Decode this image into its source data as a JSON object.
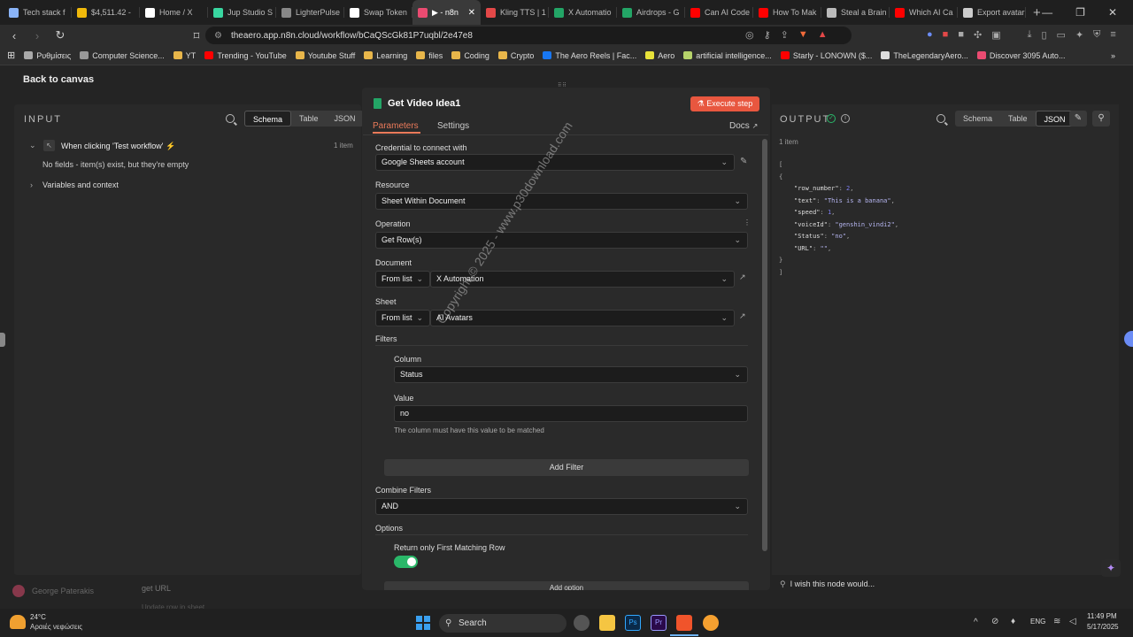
{
  "browser": {
    "tabs": [
      {
        "label": "Tech stack f",
        "color": "#8ab4f8"
      },
      {
        "label": "$4,511.42 -",
        "color": "#f0b90b"
      },
      {
        "label": "Home / X",
        "color": "#ffffff"
      },
      {
        "label": "Jup Studio S",
        "color": "#39d6a0"
      },
      {
        "label": "LighterPulse",
        "color": "#888888"
      },
      {
        "label": "Swap Token",
        "color": "#ffffff"
      },
      {
        "label": "▶ - n8n",
        "color": "#ea4b71"
      },
      {
        "label": "Kling TTS | 1",
        "color": "#e34848"
      },
      {
        "label": "X Automatio",
        "color": "#23a566"
      },
      {
        "label": "Airdrops - G",
        "color": "#23a566"
      },
      {
        "label": "Can AI Code",
        "color": "#ff0000"
      },
      {
        "label": "How To Mak",
        "color": "#ff0000"
      },
      {
        "label": "Steal a Brain",
        "color": "#bbbbbb"
      },
      {
        "label": "Which AI Ca",
        "color": "#ff0000"
      },
      {
        "label": "Export avatar",
        "color": "#cccccc"
      }
    ],
    "active_tab_index": 6,
    "url": "theaero.app.n8n.cloud/workflow/bCaQScGk81P7uqbl/2e47e8",
    "bookmarks": [
      {
        "label": "Ρυθμίσεις",
        "color": "#aaaaaa"
      },
      {
        "label": "Computer Science...",
        "color": "#999999"
      },
      {
        "label": "YT",
        "color": "#e8b64a"
      },
      {
        "label": "Trending - YouTube",
        "color": "#ff0000"
      },
      {
        "label": "Youtube Stuff",
        "color": "#e8b64a"
      },
      {
        "label": "Learning",
        "color": "#e8b64a"
      },
      {
        "label": "files",
        "color": "#e8b64a"
      },
      {
        "label": "Coding",
        "color": "#e8b64a"
      },
      {
        "label": "Crypto",
        "color": "#e8b64a"
      },
      {
        "label": "The Aero Reels | Fac...",
        "color": "#1877f2"
      },
      {
        "label": "Aero",
        "color": "#e8e23a"
      },
      {
        "label": "artificial intelligence...",
        "color": "#b6d36a"
      },
      {
        "label": "Starly - LONOWN ($...",
        "color": "#ff0000"
      },
      {
        "label": "TheLegendaryAero...",
        "color": "#dddddd"
      },
      {
        "label": "Discover 3095 Auto...",
        "color": "#ea4b71"
      }
    ]
  },
  "canvas": {
    "back_label": "Back to canvas",
    "bottom_left_user": "George Paterakis",
    "node_a": "get URL",
    "node_b": "Update row in sheet"
  },
  "input": {
    "title": "INPUT",
    "views": [
      "Schema",
      "Table",
      "JSON"
    ],
    "trigger": "When clicking 'Test workflow'",
    "count": "1 item",
    "empty_msg": "No fields - item(s) exist, but they're empty",
    "vars": "Variables and context"
  },
  "output": {
    "title": "OUTPUT",
    "views": [
      "Schema",
      "Table",
      "JSON"
    ],
    "count": "1 item",
    "json_lines": [
      {
        "t": "["
      },
      {
        "t": "  {"
      },
      {
        "k": "\"row_number\"",
        "v": "2",
        "vt": "n"
      },
      {
        "k": "\"text\"",
        "v": "\"This is a banana\"",
        "vt": "s"
      },
      {
        "k": "\"speed\"",
        "v": "1",
        "vt": "n"
      },
      {
        "k": "\"voiceId\"",
        "v": "\"genshin_vindi2\"",
        "vt": "s"
      },
      {
        "k": "\"Status\"",
        "v": "\"no\"",
        "vt": "s"
      },
      {
        "k": "\"URL\"",
        "v": "\"\"",
        "vt": "s"
      },
      {
        "t": "  }"
      },
      {
        "t": "]"
      }
    ],
    "feedback": "I wish this node would..."
  },
  "modal": {
    "title": "Get Video Idea1",
    "execute": "Execute step",
    "tabs": [
      "Parameters",
      "Settings"
    ],
    "docs": "Docs",
    "credential_label": "Credential to connect with",
    "credential_value": "Google Sheets account",
    "resource_label": "Resource",
    "resource_value": "Sheet Within Document",
    "operation_label": "Operation",
    "operation_value": "Get Row(s)",
    "document_label": "Document",
    "document_mode": "From list",
    "document_value": "X Automation",
    "sheet_label": "Sheet",
    "sheet_mode": "From list",
    "sheet_value": "AI Avatars",
    "filters_label": "Filters",
    "column_label": "Column",
    "column_value": "Status",
    "value_label": "Value",
    "value_value": "no",
    "value_hint": "The column must have this value to be matched",
    "add_filter": "Add Filter",
    "combine_label": "Combine Filters",
    "combine_value": "AND",
    "options_label": "Options",
    "first_row_label": "Return only First Matching Row",
    "first_row_on": true,
    "add_option": "Add option"
  },
  "watermark": "Copyright © 2025 - www.p30download.com",
  "taskbar": {
    "weather_temp": "24°C",
    "weather_desc": "Αραιές νεφώσεις",
    "search": "Search",
    "lang": "ENG",
    "time": "11:49 PM",
    "date": "5/17/2025"
  },
  "colors": {
    "accent": "#ea4b71",
    "execute": "#e8573f",
    "toggle": "#2ab769",
    "sheets": "#23a566"
  }
}
